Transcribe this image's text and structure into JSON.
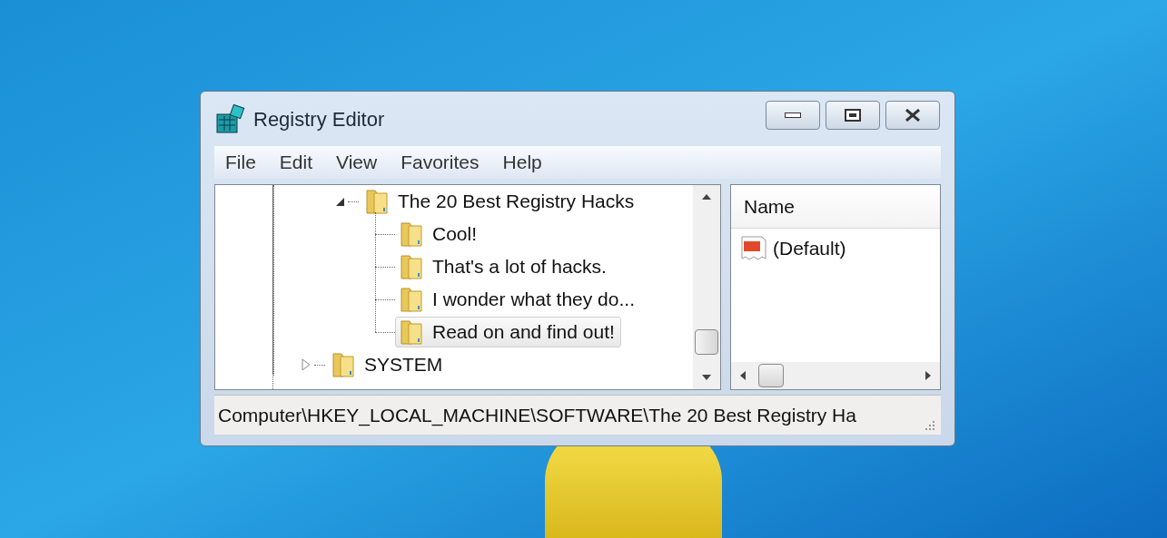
{
  "window": {
    "title": "Registry Editor"
  },
  "menu": [
    "File",
    "Edit",
    "View",
    "Favorites",
    "Help"
  ],
  "tree": [
    {
      "label": "The 20 Best Registry Hacks",
      "expanded": true,
      "selected": false,
      "children": [
        {
          "label": "Cool!",
          "selected": false
        },
        {
          "label": "That's a lot of hacks.",
          "selected": false
        },
        {
          "label": "I wonder what they do...",
          "selected": false
        },
        {
          "label": "Read on and find out!",
          "selected": true
        }
      ]
    },
    {
      "label": "SYSTEM",
      "expanded": false,
      "selected": false
    }
  ],
  "values": {
    "columns": [
      "Name"
    ],
    "rows": [
      {
        "name": "(Default)"
      }
    ]
  },
  "status_bar": "Computer\\HKEY_LOCAL_MACHINE\\SOFTWARE\\The 20 Best Registry Ha"
}
